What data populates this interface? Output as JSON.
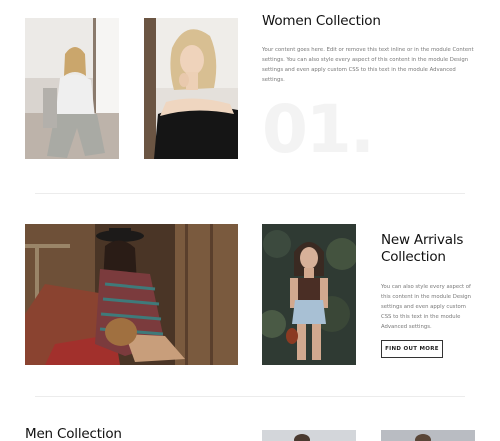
{
  "section1": {
    "title": "Women Collection",
    "description": "Your content goes here. Edit or remove this text inline or in the module Content settings. You can also style every aspect of this content in the module Design settings and even apply custom CSS to this text in the module Advanced settings.",
    "number": "01."
  },
  "section2": {
    "title_line1": "New Arrivals",
    "title_line2": "Collection",
    "description": "You can also style every aspect of this content in the module Design settings and even apply custom CSS to this text in the module Advanced settings.",
    "button_label": "FIND OUT MORE"
  },
  "section3": {
    "title": "Men Collection"
  }
}
